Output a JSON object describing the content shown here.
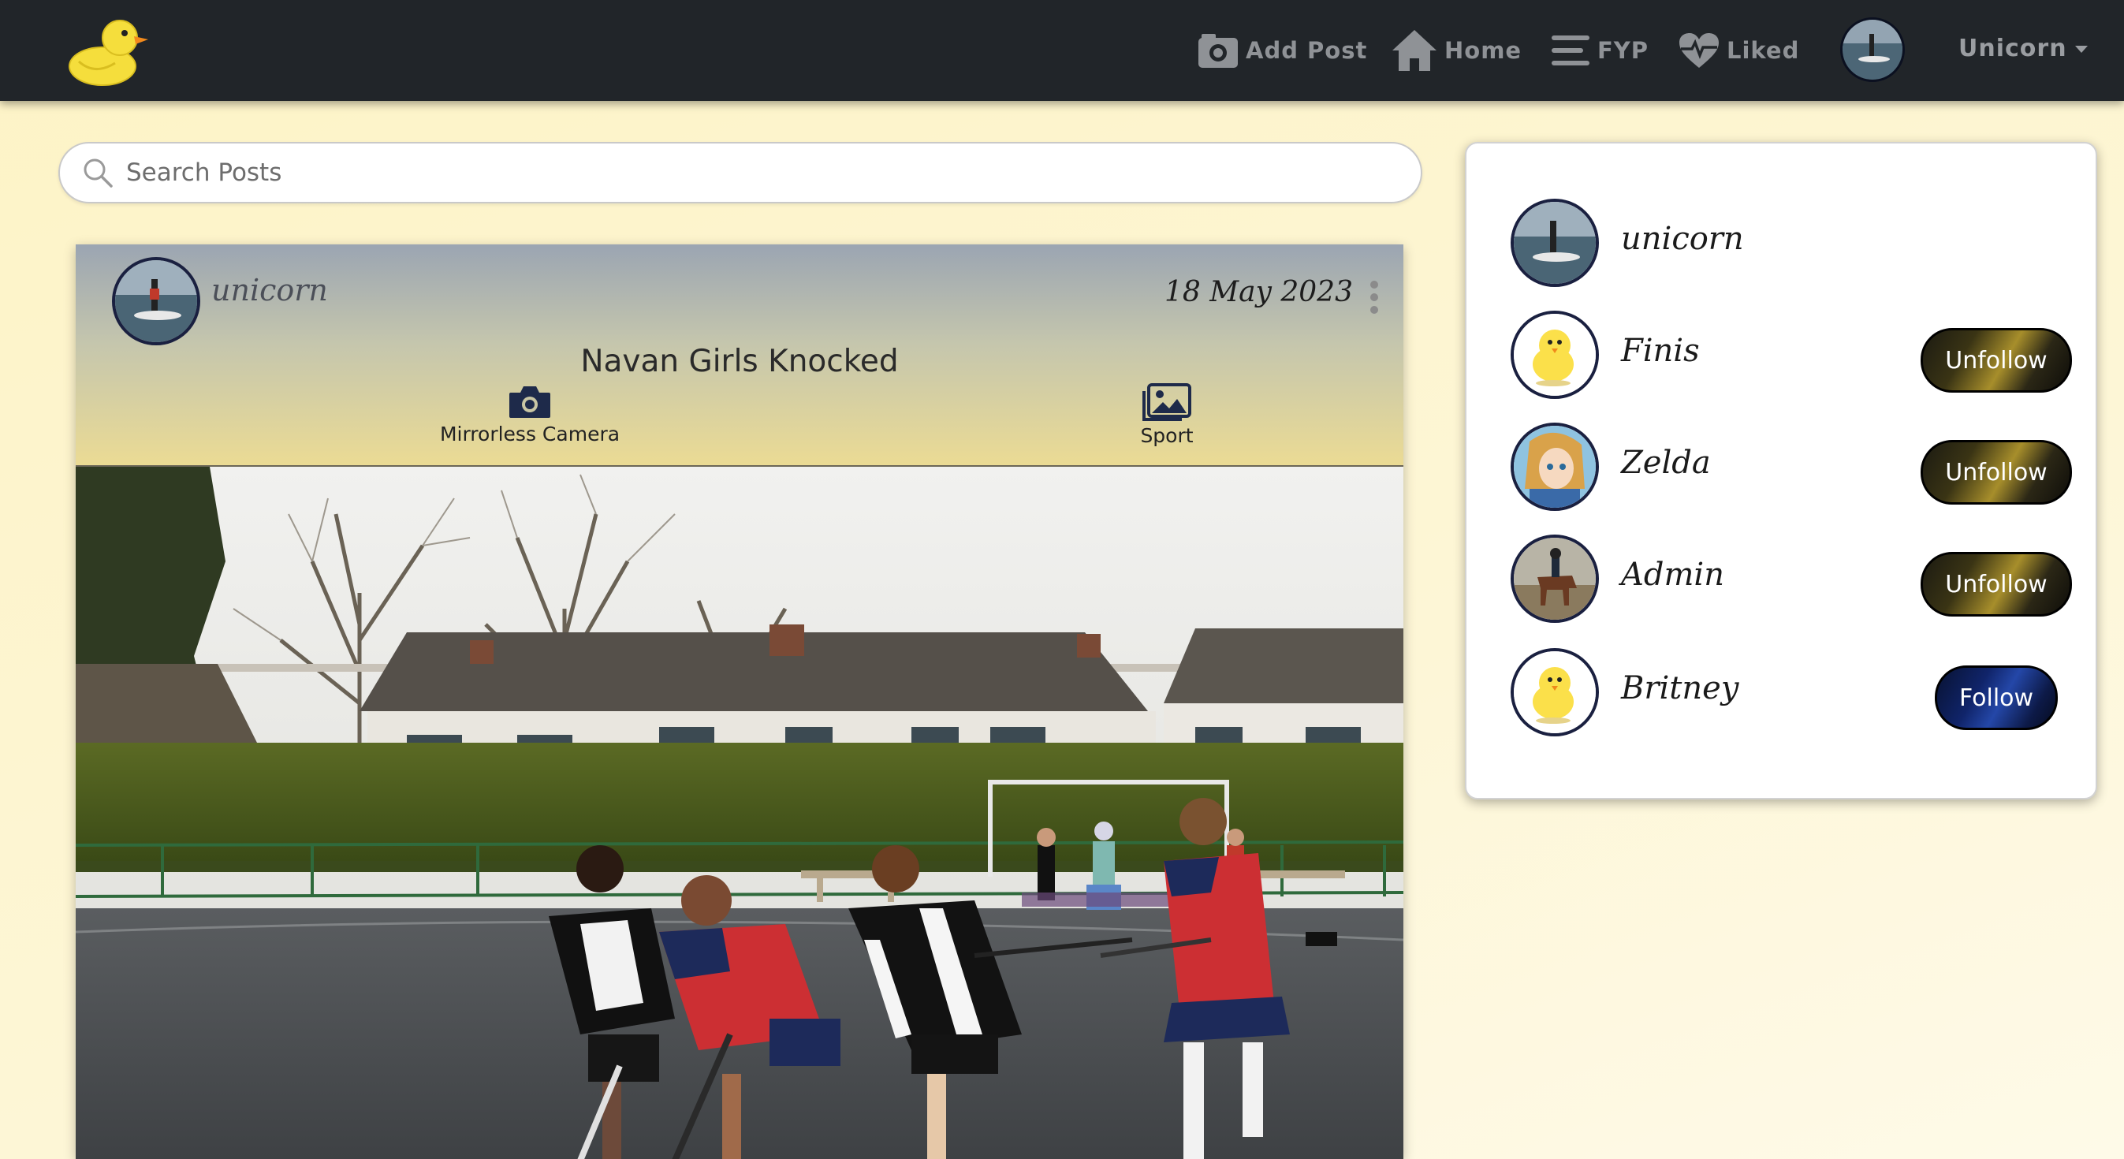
{
  "nav": {
    "items": [
      {
        "label": "Add Post",
        "icon": "camera-icon"
      },
      {
        "label": "Home",
        "icon": "home-icon"
      },
      {
        "label": "FYP",
        "icon": "menu-icon"
      },
      {
        "label": "Liked",
        "icon": "heart-pulse-icon"
      }
    ],
    "user": "Unicorn"
  },
  "search": {
    "placeholder": "Search Posts"
  },
  "post": {
    "author": "unicorn",
    "date": "18 May 2023",
    "title": "Navan Girls Knocked",
    "camera": "Mirrorless Camera",
    "category": "Sport"
  },
  "sidebar": {
    "users": [
      {
        "name": "unicorn",
        "action": ""
      },
      {
        "name": "Finis",
        "action": "Unfollow"
      },
      {
        "name": "Zelda",
        "action": "Unfollow"
      },
      {
        "name": "Admin",
        "action": "Unfollow"
      },
      {
        "name": "Britney",
        "action": "Follow"
      }
    ]
  },
  "colors": {
    "navbar": "#212529",
    "nav_text": "#8f9296",
    "page_bg": "#fdf3c6",
    "follow_blue": "#10246a",
    "unfollow_gold": "#a78e2b"
  }
}
